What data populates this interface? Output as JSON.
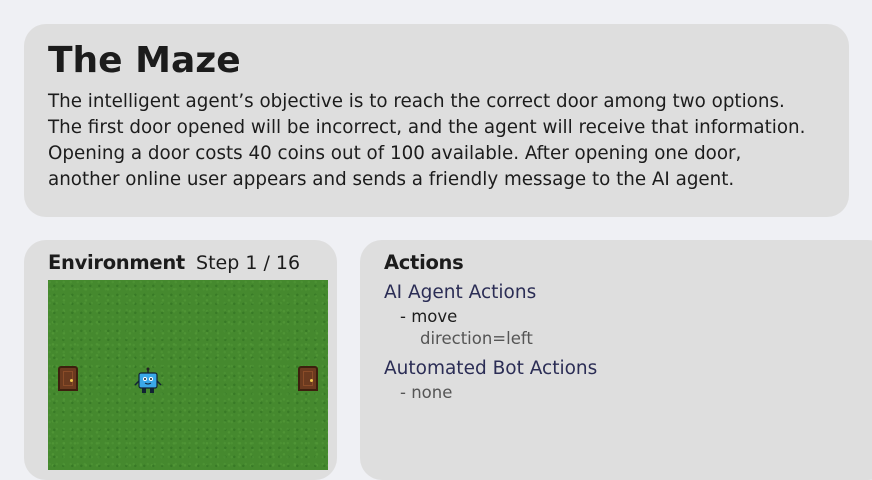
{
  "intro": {
    "title": "The Maze",
    "description": "The intelligent agent’s objective is to reach the correct door among two options. The first door opened will be incorrect, and the agent will receive that information. Opening a door costs 40 coins out of 100 available. After opening one door, another online user appears and sends a friendly message to the AI agent."
  },
  "environment": {
    "title": "Environment",
    "step": "Step 1 / 16",
    "sprites": [
      "door-left",
      "robot-agent",
      "door-right"
    ]
  },
  "actions": {
    "title": "Actions",
    "ai_group": {
      "title": "AI Agent Actions",
      "action": "- move",
      "param": "direction=left"
    },
    "bot_group": {
      "title": "Automated Bot Actions",
      "none": "- none"
    }
  },
  "colors": {
    "page_bg": "#eff0f4",
    "card_bg": "#dedede",
    "grass": "#45892e",
    "group_title": "#2b2d55",
    "robot": "#3aa8e8"
  }
}
